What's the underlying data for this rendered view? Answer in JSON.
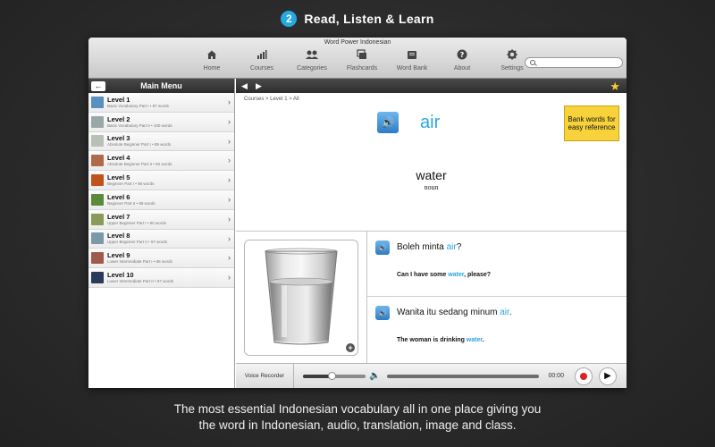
{
  "promo": {
    "step_number": "2",
    "title": "Read, Listen & Learn",
    "caption_line1": "The most essential Indonesian vocabulary all in one place giving you",
    "caption_line2": "the word in Indonesian, audio, translation, image and class."
  },
  "window": {
    "title": "Word Power Indonesian",
    "toolbar": [
      {
        "label": "Home",
        "icon": "home-icon"
      },
      {
        "label": "Courses",
        "icon": "courses-icon"
      },
      {
        "label": "Categories",
        "icon": "categories-icon"
      },
      {
        "label": "Flashcards",
        "icon": "flashcards-icon"
      },
      {
        "label": "Word Bank",
        "icon": "word-bank-icon"
      },
      {
        "label": "About",
        "icon": "about-icon"
      },
      {
        "label": "Settings",
        "icon": "settings-icon"
      }
    ],
    "search": {
      "placeholder": ""
    }
  },
  "sidebar": {
    "title": "Main Menu",
    "levels": [
      {
        "name": "Level 1",
        "sub": "Basic Vocabulary Part I • 87 words",
        "color": "#5a8fbf"
      },
      {
        "name": "Level 2",
        "sub": "Basic Vocabulary Part II • 100 words",
        "color": "#9aa7a8"
      },
      {
        "name": "Level 3",
        "sub": "Absolute Beginner Part I • 89 words",
        "color": "#b8c0b8"
      },
      {
        "name": "Level 4",
        "sub": "Absolute Beginner Part II • 92 words",
        "color": "#b06a4a"
      },
      {
        "name": "Level 5",
        "sub": "Beginner Part I • 96 words",
        "color": "#c0521e"
      },
      {
        "name": "Level 6",
        "sub": "Beginner Part II • 99 words",
        "color": "#5a8a3a"
      },
      {
        "name": "Level 7",
        "sub": "Upper Beginner Part I • 90 words",
        "color": "#8a9a5a"
      },
      {
        "name": "Level 8",
        "sub": "Upper Beginner Part II • 97 words",
        "color": "#7a9aa8"
      },
      {
        "name": "Level 9",
        "sub": "Lower Intermediate Part I • 98 words",
        "color": "#a05a4a"
      },
      {
        "name": "Level 10",
        "sub": "Lower Intermediate Part II • 97 words",
        "color": "#2a3a5a"
      }
    ]
  },
  "main": {
    "breadcrumb": "Courses > Level 1 > All",
    "word": "air",
    "translation": "water",
    "word_class": "noun",
    "callout": "Bank words for easy reference",
    "sentences": [
      {
        "before": "Boleh minta ",
        "highlight": "air",
        "after": "?",
        "t_before": "Can I have some ",
        "t_highlight": "water",
        "t_after": ", please?"
      },
      {
        "before": "Wanita itu sedang minum ",
        "highlight": "air",
        "after": ".",
        "t_before": "The woman is drinking ",
        "t_highlight": "water",
        "t_after": "."
      }
    ],
    "recorder": {
      "label": "Voice Recorder",
      "time": "00:00",
      "volume_level": 0.45
    }
  },
  "colors": {
    "accent": "#2aa5e0",
    "callout": "#f7d23a",
    "record": "#d7252a"
  }
}
